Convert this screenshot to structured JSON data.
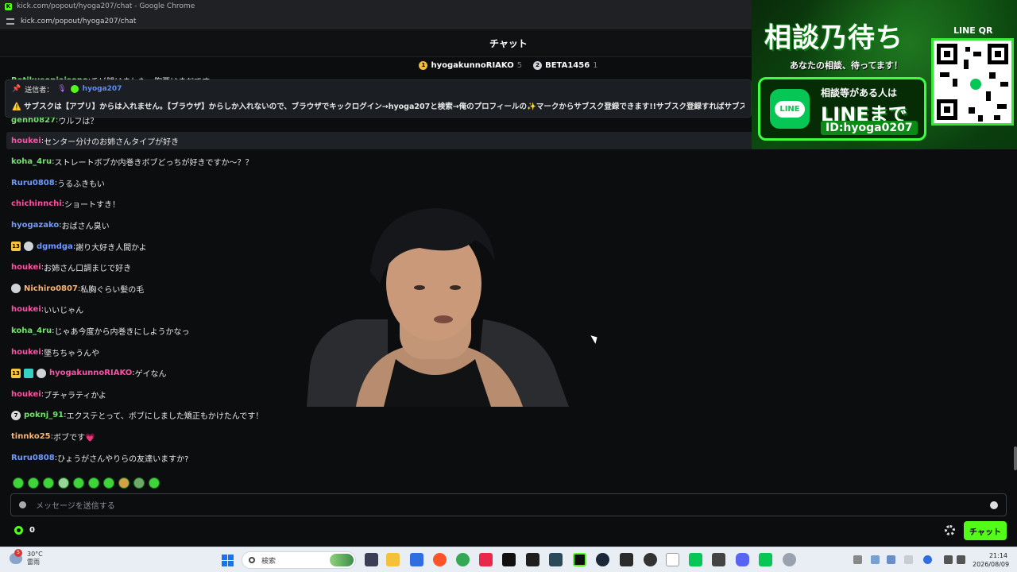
{
  "browser": {
    "window_title": "kick.com/popout/hyoga207/chat - Google Chrome",
    "url": "kick.com/popout/hyoga207/chat"
  },
  "chat": {
    "header_title": "チャット",
    "top_gifters": [
      {
        "name": "hyogakunnoRIAKO",
        "count": "5",
        "rank": "1",
        "color": "#f5b942"
      },
      {
        "name": "BETA1456",
        "count": "1",
        "rank": "2",
        "color": "#cfd3d8"
      }
    ],
    "pinned": {
      "sender_label": "送信者：",
      "sender_name": "hyoga207",
      "text": "サブスクは【アプリ】からは入れません。【ブラウザ】からしか入れないので、ブラウザでキックログイン→hyoga207と検索→俺のプロフィールの✨マークからサブスク登録できます!!サブスク登録すればサブスク限定",
      "warn_icon": "⚠️"
    },
    "partial_messages": [
      {
        "user": "Ratikusoniaisono",
        "text": "チビ腿はました　胸要はまだです"
      },
      {
        "user": "genh0827",
        "text": "ウルフは？"
      }
    ],
    "messages": [
      {
        "user": "houkei",
        "text": "センター分けのお姉さんタイプが好き",
        "color": "#ff4fa3"
      },
      {
        "user": "koha_4ru",
        "text": "ストレートボブか内巻きボブどっちが好きですか〜？？",
        "color": "#72e36b"
      },
      {
        "user": "Ruru0808",
        "text": "うるふきもい",
        "color": "#6f9bff"
      },
      {
        "user": "chichinnchi",
        "text": "ショートすき！",
        "color": "#ff4fa3"
      },
      {
        "user": "hyogazako",
        "text": "おばさん臭い",
        "color": "#6f9bff"
      },
      {
        "user": "dgmdga",
        "text": "謝り大好き人間かよ",
        "color": "#6f9bff",
        "badges": [
          "13",
          "avatar"
        ]
      },
      {
        "user": "houkei",
        "text": "お姉さん口調まじで好き",
        "color": "#ff4fa3"
      },
      {
        "user": "Nichiro0807",
        "text": "私胸ぐらい髪の毛",
        "color": "#ffb36b",
        "badges": [
          "avatar"
        ]
      },
      {
        "user": "houkei",
        "text": "いいじゃん",
        "color": "#ff4fa3"
      },
      {
        "user": "koha_4ru",
        "text": "じゃあ今度から内巻きにしようかなっ",
        "color": "#72e36b"
      },
      {
        "user": "houkei",
        "text": "墜ちちゃうんや",
        "color": "#ff4fa3"
      },
      {
        "user": "hyogakunnoRIAKO",
        "text": "ゲイなん",
        "color": "#ff4fa3",
        "badges": [
          "13",
          "gift",
          "avatar"
        ]
      },
      {
        "user": "houkei",
        "text": "ブチャラティかよ",
        "color": "#ff4fa3"
      },
      {
        "user": "poknj_91",
        "text": "エクステとって、ボブにしました矯正もかけたんです！",
        "color": "#72e36b",
        "badges": [
          "7"
        ]
      },
      {
        "user": "tinnko25",
        "text": "ボブです💗",
        "color": "#ffb36b"
      },
      {
        "user": "Ruru0808",
        "text": "ひょうがさんやりらの友達いますか?",
        "color": "#6f9bff"
      }
    ],
    "input_placeholder": "メッセージを送信する",
    "points": "0",
    "send_label": "チャット"
  },
  "ad": {
    "title": "相談乃待ち",
    "subtitle": "あなたの相談、待ってます！",
    "line_text_1": "相談等がある人は",
    "line_text_2": "LINEまで",
    "line_id": "ID:hyoga0207",
    "line_logo": "LINE",
    "qr_label": "LINE QR"
  },
  "taskbar": {
    "temperature": "30°C",
    "weather": "雷雨",
    "weather_badge": "5",
    "search_placeholder": "検索",
    "time": "21:14",
    "date": "2026/08/09"
  }
}
